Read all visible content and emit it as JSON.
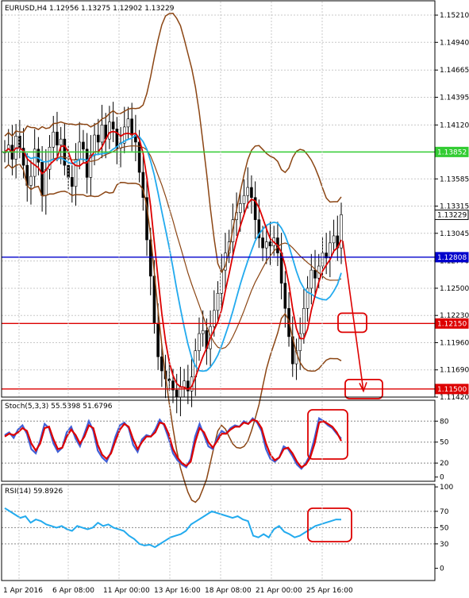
{
  "header": {
    "symbol_line": "EURUSD,H4  1.12956 1.13275 1.12902 1.13229",
    "stoch_label": "Stoch(5,3,3) 55.5398 51.6796",
    "rsi_label": "RSI(14) 59.8926"
  },
  "chart_data": [
    {
      "type": "candlestick",
      "title": "EURUSD,H4",
      "ohlc_last": {
        "open": 1.12956,
        "high": 1.13275,
        "low": 1.12902,
        "close": 1.13229
      },
      "ylim": [
        1.1142,
        1.1536
      ],
      "y_ticks": [
        "1.15210",
        "1.14940",
        "1.14665",
        "1.14395",
        "1.14120",
        "1.13585",
        "1.13315",
        "1.13045",
        "1.12770",
        "1.12500",
        "1.12230",
        "1.11960",
        "1.11690",
        "1.11420"
      ],
      "x_ticks": [
        "1 Apr 2016",
        "6 Apr 08:00",
        "11 Apr 00:00",
        "13 Apr 16:00",
        "18 Apr 08:00",
        "21 Apr 00:00",
        "25 Apr 16:00"
      ],
      "levels": [
        {
          "value": 1.13852,
          "label": "1.13852",
          "color": "#33cc33"
        },
        {
          "value": 1.13229,
          "label": "1.13229",
          "color": "#ffffff"
        },
        {
          "value": 1.12808,
          "label": "1.12808",
          "color": "#0000cc"
        },
        {
          "value": 1.1215,
          "label": "1.12150",
          "color": "#dd0000"
        },
        {
          "value": 1.115,
          "label": "1.11500",
          "color": "#dd0000"
        }
      ],
      "closes": [
        1.1385,
        1.1392,
        1.1378,
        1.1401,
        1.1389,
        1.1372,
        1.1352,
        1.1361,
        1.1388,
        1.1375,
        1.1342,
        1.1368,
        1.139,
        1.1405,
        1.1392,
        1.1398,
        1.1372,
        1.136,
        1.1351,
        1.1378,
        1.1395,
        1.1388,
        1.136,
        1.1382,
        1.1402,
        1.1395,
        1.1412,
        1.1398,
        1.1415,
        1.1408,
        1.1389,
        1.1394,
        1.141,
        1.1418,
        1.1402,
        1.1395,
        1.1365,
        1.134,
        1.1298,
        1.1262,
        1.1215,
        1.1182,
        1.1168,
        1.116,
        1.1158,
        1.1149,
        1.1142,
        1.1152,
        1.1158,
        1.1148,
        1.1162,
        1.1188,
        1.1205,
        1.1208,
        1.119,
        1.1212,
        1.1228,
        1.1245,
        1.1268,
        1.1285,
        1.1296,
        1.1318,
        1.1325,
        1.1334,
        1.1342,
        1.135,
        1.134,
        1.1318,
        1.13,
        1.129,
        1.1296,
        1.1292,
        1.13,
        1.1285,
        1.1255,
        1.123,
        1.1202,
        1.1175,
        1.1188,
        1.1205,
        1.123,
        1.125,
        1.1268,
        1.126,
        1.1272,
        1.1285,
        1.128,
        1.1295,
        1.1302,
        1.129,
        1.1323
      ],
      "bands_period": 20,
      "ma_fast": 5,
      "ma_slow": 13,
      "projection": {
        "from": 1.1297,
        "to": 1.1148,
        "note": "arrow toward 1.11500"
      },
      "highlight_boxes": [
        {
          "level": 1.1215
        },
        {
          "level": 1.115
        }
      ]
    },
    {
      "type": "line",
      "title": "Stoch(5,3,3)",
      "ylim": [
        0,
        100
      ],
      "y_ticks": [
        "80",
        "50",
        "20",
        "0"
      ],
      "levels": [
        80,
        50,
        20
      ],
      "series": [
        {
          "name": "Main",
          "color": "#4060d8",
          "last": 55.5398
        },
        {
          "name": "Signal",
          "color": "#dd0000",
          "last": 51.6796
        }
      ],
      "main": [
        60,
        64,
        56,
        68,
        74,
        62,
        40,
        34,
        52,
        76,
        70,
        48,
        36,
        42,
        64,
        72,
        55,
        44,
        62,
        80,
        66,
        38,
        28,
        22,
        36,
        58,
        74,
        78,
        70,
        46,
        36,
        54,
        60,
        58,
        68,
        82,
        74,
        56,
        34,
        24,
        18,
        14,
        26,
        58,
        76,
        60,
        44,
        40,
        56,
        66,
        62,
        70,
        74,
        72,
        80,
        76,
        84,
        78,
        66,
        40,
        26,
        22,
        28,
        44,
        40,
        30,
        18,
        12,
        20,
        32,
        56,
        84,
        80,
        74,
        70,
        62,
        55
      ],
      "signal": [
        58,
        62,
        60,
        64,
        70,
        66,
        48,
        38,
        48,
        70,
        72,
        54,
        40,
        42,
        58,
        68,
        60,
        48,
        58,
        74,
        70,
        46,
        32,
        26,
        34,
        52,
        68,
        76,
        72,
        54,
        40,
        50,
        58,
        58,
        64,
        78,
        76,
        62,
        40,
        28,
        20,
        16,
        22,
        50,
        70,
        64,
        50,
        42,
        52,
        62,
        62,
        68,
        72,
        72,
        78,
        76,
        82,
        80,
        70,
        48,
        32,
        24,
        28,
        40,
        42,
        34,
        22,
        14,
        18,
        28,
        48,
        78,
        80,
        76,
        72,
        64,
        51.7
      ]
    },
    {
      "type": "line",
      "title": "RSI(14)",
      "ylim": [
        0,
        100
      ],
      "y_ticks": [
        "100",
        "70",
        "50",
        "30",
        "0"
      ],
      "levels": [
        70,
        50,
        30
      ],
      "series": [
        {
          "name": "RSI(14)",
          "color": "#22aaee",
          "last": 59.8926
        }
      ],
      "values": [
        74,
        70,
        66,
        62,
        64,
        56,
        60,
        58,
        54,
        52,
        50,
        52,
        48,
        46,
        52,
        50,
        48,
        50,
        56,
        52,
        54,
        50,
        48,
        46,
        40,
        36,
        30,
        28,
        29,
        26,
        30,
        34,
        38,
        40,
        42,
        46,
        54,
        58,
        62,
        66,
        70,
        68,
        66,
        64,
        62,
        64,
        60,
        58,
        40,
        38,
        42,
        38,
        48,
        52,
        45,
        42,
        38,
        40,
        44,
        48,
        52,
        54,
        56,
        58,
        60,
        59.9
      ]
    }
  ],
  "colors": {
    "bands": "#8b4513",
    "ma_fast": "#dd0000",
    "ma_slow": "#22aaee",
    "candles": "#000000",
    "grid": "#c8c8c8"
  }
}
